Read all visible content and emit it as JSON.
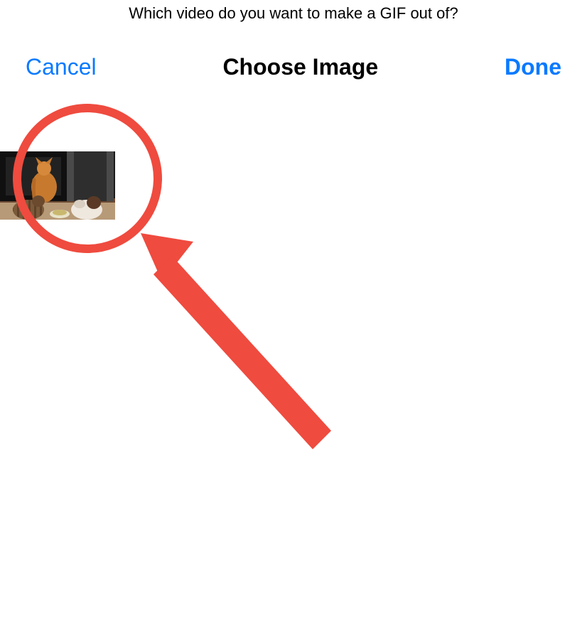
{
  "prompt": {
    "text": "Which video do you want to make a GIF out of?"
  },
  "nav": {
    "cancel_label": "Cancel",
    "title": "Choose Image",
    "done_label": "Done"
  },
  "annotation": {
    "color": "#ef4b3f"
  }
}
